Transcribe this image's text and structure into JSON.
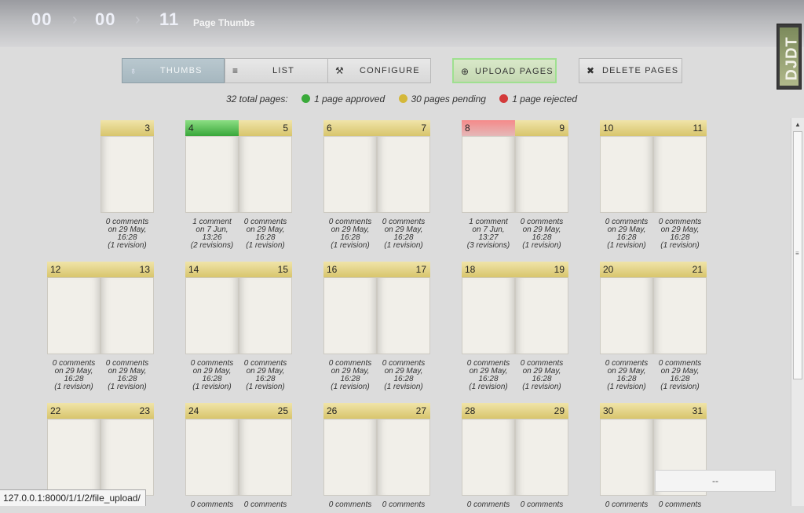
{
  "breadcrumb": {
    "crumbs": [
      "00",
      "00",
      "11"
    ],
    "title": "Page Thumbs"
  },
  "logo_text": "DJDT",
  "toolbar": {
    "thumbs": "THUMBS",
    "list": "LIST",
    "configure": "CONFIGURE",
    "upload": "UPLOAD PAGES",
    "delete": "DELETE PAGES",
    "icons": {
      "thumbs": "flask-icon",
      "list": "list-icon",
      "configure": "wrench-icon",
      "upload": "plus-circle-icon",
      "delete": "x-icon"
    }
  },
  "summary": {
    "total": "32 total pages:",
    "approved": "1 page approved",
    "pending": "30 pages pending",
    "rejected": "1 page rejected",
    "colors": {
      "approved": "#3aaa3a",
      "pending": "#d4b83a",
      "rejected": "#d33a3a"
    }
  },
  "spreads": [
    {
      "left": null,
      "right": {
        "num": "3",
        "status": "pending",
        "comments": "0 comments",
        "on": "on 29 May,",
        "time": "16:28",
        "revisions": "(1 revision)"
      }
    },
    {
      "left": {
        "num": "4",
        "status": "approved",
        "comments": "1 comment",
        "on": "on 7 Jun,",
        "time": "13:26",
        "revisions": "(2 revisions)"
      },
      "right": {
        "num": "5",
        "status": "pending",
        "comments": "0 comments",
        "on": "on 29 May,",
        "time": "16:28",
        "revisions": "(1 revision)"
      }
    },
    {
      "left": {
        "num": "6",
        "status": "pending",
        "comments": "0 comments",
        "on": "on 29 May,",
        "time": "16:28",
        "revisions": "(1 revision)"
      },
      "right": {
        "num": "7",
        "status": "pending",
        "comments": "0 comments",
        "on": "on 29 May,",
        "time": "16:28",
        "revisions": "(1 revision)"
      }
    },
    {
      "left": {
        "num": "8",
        "status": "rejected",
        "comments": "1 comment",
        "on": "on 7 Jun,",
        "time": "13:27",
        "revisions": "(3 revisions)"
      },
      "right": {
        "num": "9",
        "status": "pending",
        "comments": "0 comments",
        "on": "on 29 May,",
        "time": "16:28",
        "revisions": "(1 revision)"
      }
    },
    {
      "left": {
        "num": "10",
        "status": "pending",
        "comments": "0 comments",
        "on": "on 29 May,",
        "time": "16:28",
        "revisions": "(1 revision)"
      },
      "right": {
        "num": "11",
        "status": "pending",
        "comments": "0 comments",
        "on": "on 29 May,",
        "time": "16:28",
        "revisions": "(1 revision)"
      }
    },
    {
      "left": {
        "num": "12",
        "status": "pending",
        "comments": "0 comments",
        "on": "on 29 May,",
        "time": "16:28",
        "revisions": "(1 revision)"
      },
      "right": {
        "num": "13",
        "status": "pending",
        "comments": "0 comments",
        "on": "on 29 May,",
        "time": "16:28",
        "revisions": "(1 revision)"
      }
    },
    {
      "left": {
        "num": "14",
        "status": "pending",
        "comments": "0 comments",
        "on": "on 29 May,",
        "time": "16:28",
        "revisions": "(1 revision)"
      },
      "right": {
        "num": "15",
        "status": "pending",
        "comments": "0 comments",
        "on": "on 29 May,",
        "time": "16:28",
        "revisions": "(1 revision)"
      }
    },
    {
      "left": {
        "num": "16",
        "status": "pending",
        "comments": "0 comments",
        "on": "on 29 May,",
        "time": "16:28",
        "revisions": "(1 revision)"
      },
      "right": {
        "num": "17",
        "status": "pending",
        "comments": "0 comments",
        "on": "on 29 May,",
        "time": "16:28",
        "revisions": "(1 revision)"
      }
    },
    {
      "left": {
        "num": "18",
        "status": "pending",
        "comments": "0 comments",
        "on": "on 29 May,",
        "time": "16:28",
        "revisions": "(1 revision)"
      },
      "right": {
        "num": "19",
        "status": "pending",
        "comments": "0 comments",
        "on": "on 29 May,",
        "time": "16:28",
        "revisions": "(1 revision)"
      }
    },
    {
      "left": {
        "num": "20",
        "status": "pending",
        "comments": "0 comments",
        "on": "on 29 May,",
        "time": "16:28",
        "revisions": "(1 revision)"
      },
      "right": {
        "num": "21",
        "status": "pending",
        "comments": "0 comments",
        "on": "on 29 May,",
        "time": "16:28",
        "revisions": "(1 revision)"
      }
    },
    {
      "left": {
        "num": "22",
        "status": "pending"
      },
      "right": {
        "num": "23",
        "status": "pending"
      }
    },
    {
      "left": {
        "num": "24",
        "status": "pending",
        "comments": "0 comments"
      },
      "right": {
        "num": "25",
        "status": "pending",
        "comments": "0 comments"
      }
    },
    {
      "left": {
        "num": "26",
        "status": "pending",
        "comments": "0 comments"
      },
      "right": {
        "num": "27",
        "status": "pending",
        "comments": "0 comments"
      }
    },
    {
      "left": {
        "num": "28",
        "status": "pending",
        "comments": "0 comments"
      },
      "right": {
        "num": "29",
        "status": "pending",
        "comments": "0 comments"
      }
    },
    {
      "left": {
        "num": "30",
        "status": "pending",
        "comments": "0 comments"
      },
      "right": {
        "num": "31",
        "status": "pending",
        "comments": "0 comments"
      }
    }
  ],
  "status_widget": "--",
  "status_bar_url": "127.0.0.1:8000/1/1/2/file_upload/"
}
